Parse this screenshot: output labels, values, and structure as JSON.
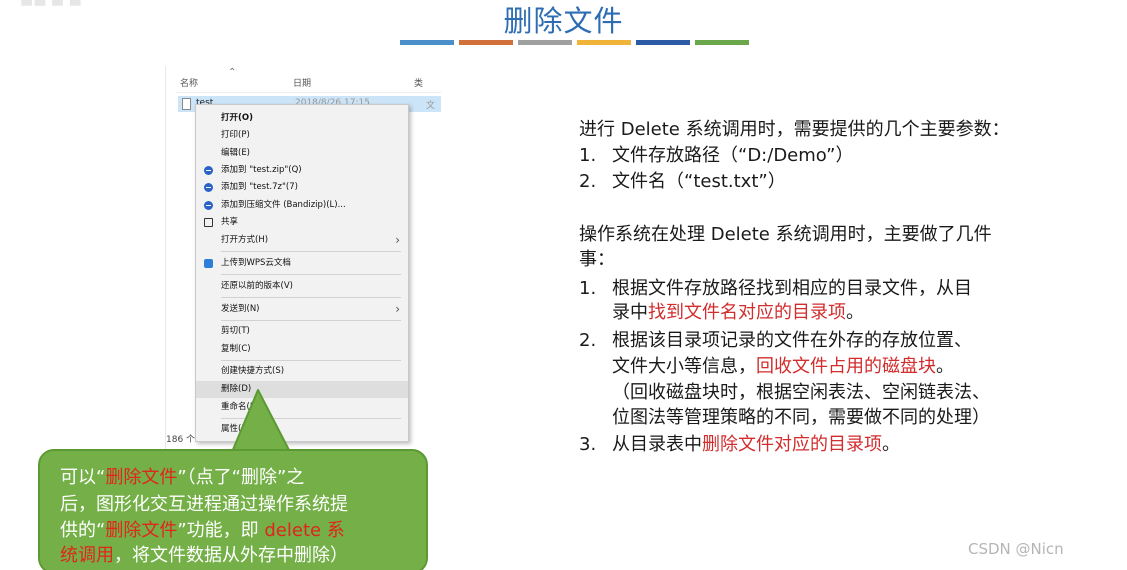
{
  "slide": {
    "title": "删除文件",
    "stripe_colors": [
      "#4a8fc9",
      "#d2703a",
      "#a0a0a0",
      "#f0b43a",
      "#2d5aa5",
      "#6aa64a"
    ],
    "watermark": "CSDN @Nicn"
  },
  "explorer": {
    "col_name": "名称",
    "col_date": "日期",
    "col_type": "类",
    "file_name": "test",
    "file_date": "2018/8/26 17:15",
    "file_type": "文",
    "item_count": "186 个"
  },
  "context_menu": {
    "items": [
      {
        "label": "打开(O)"
      },
      {
        "label": "打印(P)"
      },
      {
        "label": "编辑(E)"
      },
      {
        "label": "添加到 \"test.zip\"(Q)"
      },
      {
        "label": "添加到 \"test.7z\"(7)"
      },
      {
        "label": "添加到压缩文件 (Bandizip)(L)..."
      },
      {
        "label": "共享"
      },
      {
        "label": "打开方式(H)"
      },
      {
        "label": "上传到WPS云文档"
      },
      {
        "label": "还原以前的版本(V)"
      },
      {
        "label": "发送到(N)"
      },
      {
        "label": "剪切(T)"
      },
      {
        "label": "复制(C)"
      },
      {
        "label": "创建快捷方式(S)"
      },
      {
        "label": "删除(D)"
      },
      {
        "label": "重命名(M)"
      },
      {
        "label": "属性(R)"
      }
    ]
  },
  "content": {
    "p1": "进行 Delete 系统调用时，需要提供的几个主要参数：",
    "p1_items": [
      {
        "num": "1.",
        "text": "文件存放路径（“D:/Demo”）"
      },
      {
        "num": "2.",
        "text": "文件名（“test.txt”）"
      }
    ],
    "p2_line1": "操作系统在处理 Delete 系统调用时，主要做了几件",
    "p2_line2": "事：",
    "s1": {
      "num": "1.",
      "line1": "根据文件存放路径找到相应的目录文件，从目",
      "line2_pre": "录中",
      "line2_red": "找到文件名对应的目录项",
      "line2_post": "。"
    },
    "s2": {
      "num": "2.",
      "line1": "根据该目录项记录的文件在外存的存放位置、",
      "line2_pre": "文件大小等信息，",
      "line2_red": "回收文件占用的磁盘块",
      "line2_post": "。",
      "line3": "（回收磁盘块时，根据空闲表法、空闲链表法、",
      "line4": "位图法等管理策略的不同，需要做不同的处理）"
    },
    "s3": {
      "num": "3.",
      "pre": "从目录表中",
      "red": "删除文件对应的目录项",
      "post": "。"
    }
  },
  "callout": {
    "l1_a": "可以“",
    "l1_red": "删除文件",
    "l1_b": "”（点了“删除”之",
    "l2": "后，图形化交互进程通过操作系统提",
    "l3_a": "供的“",
    "l3_red": "删除文件",
    "l3_b": "”功能，即 ",
    "l3_red2": "delete 系",
    "l4_red": "统调用",
    "l4_b": "，将文件数据从外存中删除）"
  }
}
